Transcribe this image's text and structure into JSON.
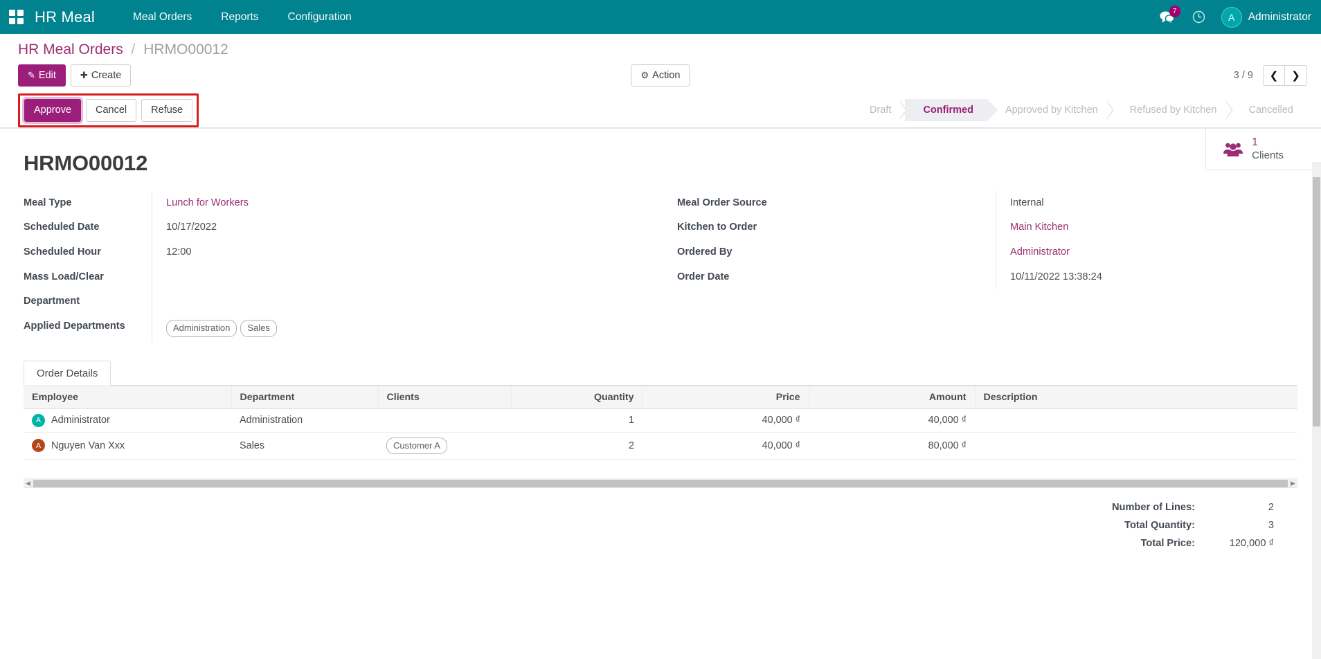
{
  "navbar": {
    "apps_icon": "apps-grid-icon",
    "brand": "HR Meal",
    "menu": [
      {
        "label": "Meal Orders"
      },
      {
        "label": "Reports"
      },
      {
        "label": "Configuration"
      }
    ],
    "messages_icon": "messages-icon",
    "messages_count": "7",
    "activity_icon": "clock-icon",
    "user_initial": "A",
    "user_name": "Administrator"
  },
  "control_panel": {
    "breadcrumb_root": "HR Meal Orders",
    "breadcrumb_sep": "/",
    "breadcrumb_current": "HRMO00012",
    "edit_label": "Edit",
    "edit_icon": "pencil-icon",
    "create_label": "Create",
    "create_icon": "plus-icon",
    "action_label": "Action",
    "action_icon": "gear-icon",
    "pager_label": "3 / 9",
    "pager_prev_icon": "chevron-left-icon",
    "pager_next_icon": "chevron-right-icon"
  },
  "actions": {
    "approve_label": "Approve",
    "cancel_label": "Cancel",
    "refuse_label": "Refuse"
  },
  "statusbar": [
    {
      "label": "Draft",
      "state": "done"
    },
    {
      "label": "Confirmed",
      "state": "active"
    },
    {
      "label": "Approved by Kitchen",
      "state": "todo"
    },
    {
      "label": "Refused by Kitchen",
      "state": "todo"
    },
    {
      "label": "Cancelled",
      "state": "todo"
    }
  ],
  "stat_button": {
    "icon": "users-group-icon",
    "value": "1",
    "label": "Clients"
  },
  "record": {
    "title": "HRMO00012",
    "left_fields": [
      {
        "label": "Meal Type",
        "value": "Lunch for Workers",
        "is_link": true
      },
      {
        "label": "Scheduled Date",
        "value": "10/17/2022",
        "is_link": false
      },
      {
        "label": "Scheduled Hour",
        "value": "12:00",
        "is_link": false
      },
      {
        "label": "Mass Load/Clear",
        "value": "",
        "is_link": false
      },
      {
        "label": "Department",
        "value": "",
        "is_link": false
      }
    ],
    "applied_departments_label": "Applied Departments",
    "applied_departments": [
      "Administration",
      "Sales"
    ],
    "right_fields": [
      {
        "label": "Meal Order Source",
        "value": "Internal",
        "is_link": false
      },
      {
        "label": "Kitchen to Order",
        "value": "Main Kitchen",
        "is_link": true
      },
      {
        "label": "Ordered By",
        "value": "Administrator",
        "is_link": true
      },
      {
        "label": "Order Date",
        "value": "10/11/2022 13:38:24",
        "is_link": false
      }
    ]
  },
  "notebook": {
    "tabs": [
      {
        "label": "Order Details",
        "active": true
      }
    ]
  },
  "order_lines": {
    "columns": [
      {
        "label": "Employee",
        "align": "left"
      },
      {
        "label": "Department",
        "align": "left"
      },
      {
        "label": "Clients",
        "align": "left"
      },
      {
        "label": "Quantity",
        "align": "right"
      },
      {
        "label": "Price",
        "align": "right"
      },
      {
        "label": "Amount",
        "align": "right"
      },
      {
        "label": "Description",
        "align": "left"
      }
    ],
    "rows": [
      {
        "employee": "Administrator",
        "avatar_initial": "A",
        "avatar_color": "#00b3a4",
        "department": "Administration",
        "clients": [],
        "quantity": "1",
        "price": "40,000 ₫",
        "amount": "40,000 ₫",
        "description": ""
      },
      {
        "employee": "Nguyen Van Xxx",
        "avatar_initial": "A",
        "avatar_color": "#b5481b",
        "department": "Sales",
        "clients": [
          "Customer A"
        ],
        "quantity": "2",
        "price": "40,000 ₫",
        "amount": "80,000 ₫",
        "description": ""
      }
    ]
  },
  "totals": [
    {
      "label": "Number of Lines:",
      "value": "2"
    },
    {
      "label": "Total Quantity:",
      "value": "3"
    },
    {
      "label": "Total Price:",
      "value": "120,000 ₫"
    }
  ],
  "colors": {
    "navbar_bg": "#00838f",
    "primary": "#9b1f7a",
    "link": "#9b2d73",
    "highlight_box": "#d81d1d"
  }
}
